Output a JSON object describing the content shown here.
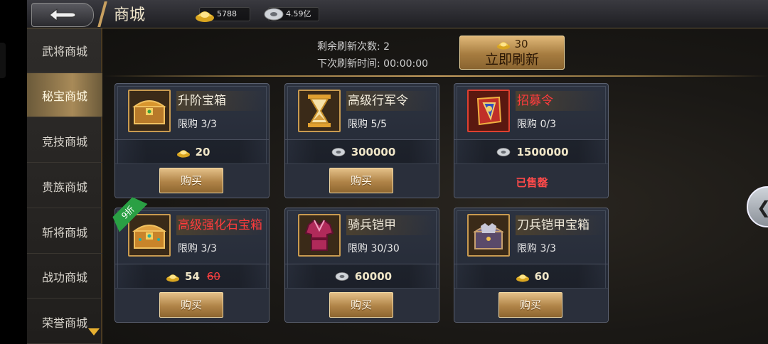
{
  "header": {
    "title": "商城",
    "gold": "5788",
    "silver": "4.59亿"
  },
  "sidebar": {
    "items": [
      {
        "label": "武将商城"
      },
      {
        "label": "秘宝商城"
      },
      {
        "label": "竞技商城"
      },
      {
        "label": "贵族商城"
      },
      {
        "label": "斩将商城"
      },
      {
        "label": "战功商城"
      },
      {
        "label": "荣誉商城"
      }
    ],
    "active_index": 1
  },
  "refresh": {
    "remaining_label": "剩余刷新次数:",
    "remaining_value": "2",
    "next_label": "下次刷新时间:",
    "next_value": "00:00:00",
    "button_cost": "30",
    "button_label": "立即刷新"
  },
  "items": [
    {
      "name": "升阶宝箱",
      "limit": "限购 3/3",
      "currency": "gold",
      "price": "20",
      "button": "购买"
    },
    {
      "name": "高级行军令",
      "limit": "限购 5/5",
      "currency": "silver",
      "price": "300000",
      "button": "购买"
    },
    {
      "name": "招募令",
      "name_color": "#ff3c3c",
      "limit": "限购 0/3",
      "currency": "silver",
      "price": "1500000",
      "sold": "已售罄"
    },
    {
      "name": "高级强化石宝箱",
      "name_color": "#ff3c3c",
      "limit": "限购 3/3",
      "currency": "gold",
      "price": "54",
      "old_price": "60",
      "discount": "9折",
      "button": "购买"
    },
    {
      "name": "骑兵铠甲",
      "limit": "限购 30/30",
      "currency": "silver",
      "price": "60000",
      "button": "购买"
    },
    {
      "name": "刀兵铠甲宝箱",
      "limit": "限购 3/3",
      "currency": "gold",
      "price": "60",
      "button": "购买"
    }
  ],
  "colors": {
    "accent_gold": "#c8a060",
    "sold_out": "#ff4a4a",
    "discount_green": "#2aa044"
  }
}
